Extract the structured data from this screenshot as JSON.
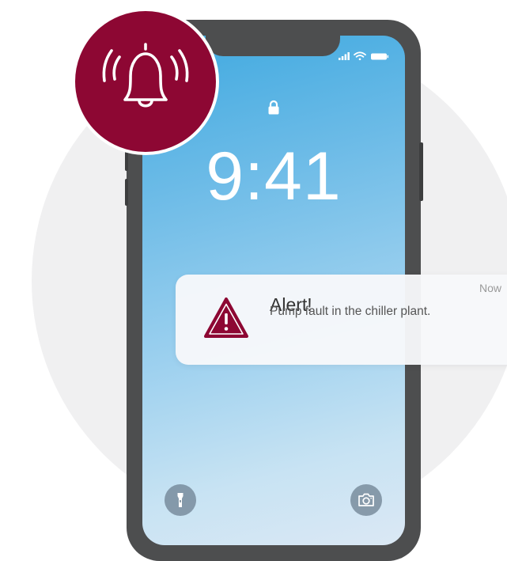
{
  "lock_screen": {
    "time": "9:41"
  },
  "notification": {
    "title": "Alert!",
    "message": "Pump fault in the chiller plant.",
    "time": "Now",
    "icon": "warning-triangle-icon"
  },
  "badge": {
    "icon": "ringing-bell-icon"
  },
  "quick_actions": {
    "left_icon": "flashlight-icon",
    "right_icon": "camera-icon"
  },
  "colors": {
    "alert_accent": "#8d0733",
    "phone_frame": "#4d4e4f",
    "screen_top": "#3fa9e0",
    "screen_bottom": "#dbe8f4",
    "background_circle": "#f0f0f1"
  }
}
